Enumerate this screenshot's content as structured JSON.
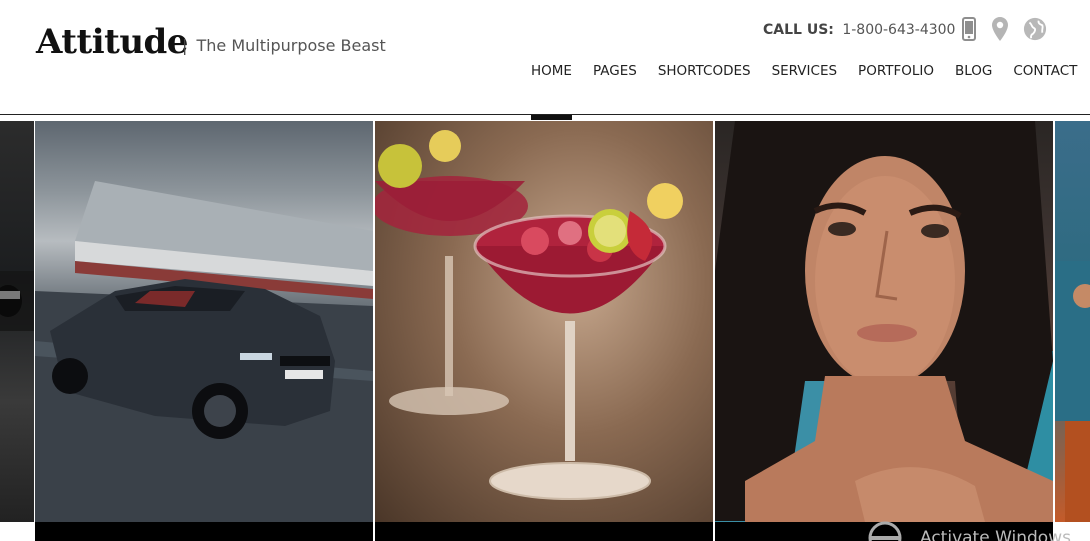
{
  "brand": {
    "name": "Attitude",
    "separator": "|",
    "tagline": "The Multipurpose Beast"
  },
  "contact": {
    "label": "CALL US:",
    "phone": "1-800-643-4300"
  },
  "header_icons": [
    "mobile-phone-icon",
    "map-pin-icon",
    "globe-icon"
  ],
  "nav": {
    "items": [
      "HOME",
      "PAGES",
      "SHORTCODES",
      "SERVICES",
      "PORTFOLIO",
      "BLOG",
      "CONTACT"
    ],
    "active": "HOME"
  },
  "gallery": {
    "tiles": [
      "motorcycle-image",
      "convertible-car-image",
      "cocktail-glass-image",
      "woman-portrait-image",
      "people-image"
    ]
  },
  "watermark": {
    "text": "Activate Windows"
  },
  "colors": {
    "text_dark": "#111111",
    "text_muted": "#555555",
    "icon_gray": "#9a9a9a",
    "active_bar": "#111111"
  }
}
